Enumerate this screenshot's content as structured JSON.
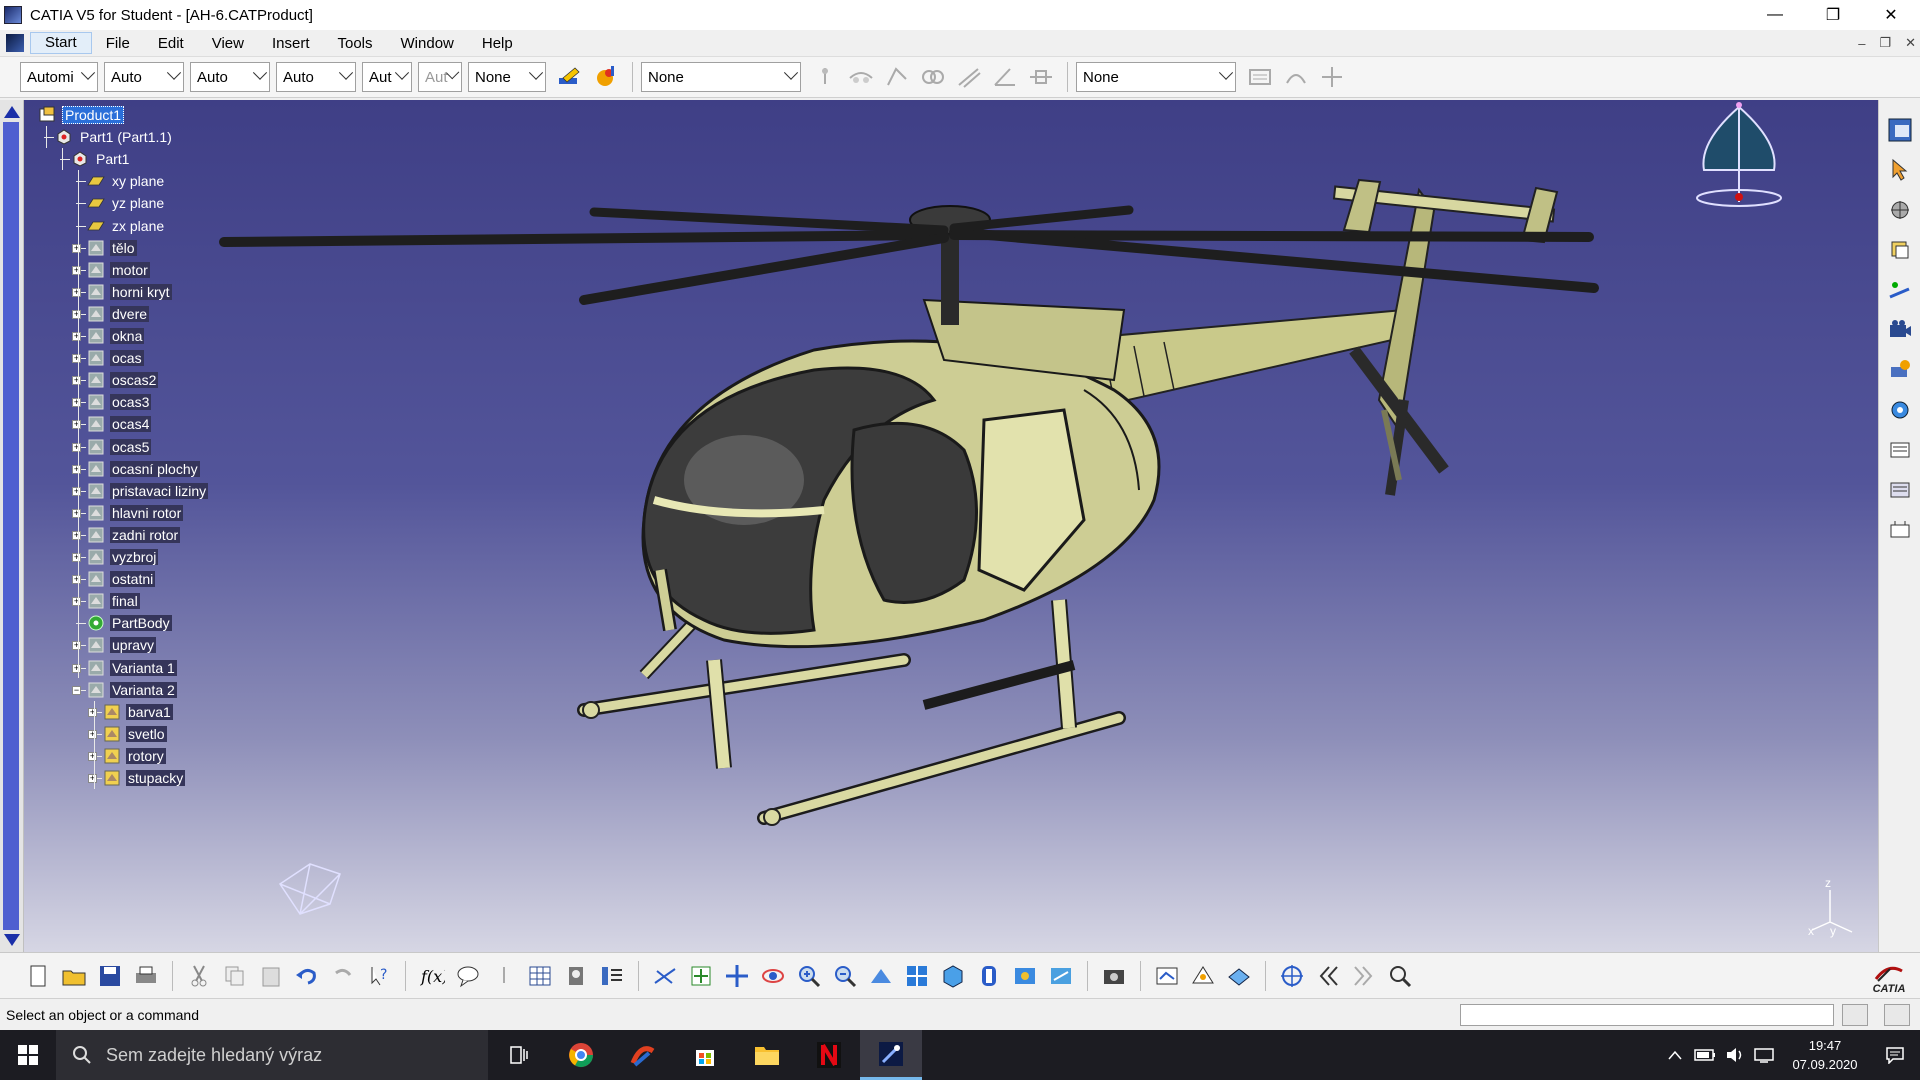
{
  "window": {
    "title": "CATIA V5 for Student - [AH-6.CATProduct]",
    "minimize": "—",
    "restore": "❐",
    "close": "✕"
  },
  "menu": {
    "items": [
      "Start",
      "File",
      "Edit",
      "View",
      "Insert",
      "Tools",
      "Window",
      "Help"
    ],
    "mdi_min": "–",
    "mdi_restore": "❐",
    "mdi_close": "✕"
  },
  "toolbar": {
    "combo1": "Automi",
    "combo2": "Auto",
    "combo3": "Auto",
    "combo4": "Auto",
    "combo5": "Aut",
    "combo6": "Aut",
    "combo7": "None",
    "combo8": "None",
    "combo9": "None"
  },
  "tree": {
    "root": "Product1",
    "part_instance": "Part1 (Part1.1)",
    "part": "Part1",
    "items": [
      "xy plane",
      "yz plane",
      "zx plane",
      "tělo",
      "motor",
      "horni kryt",
      "dvere",
      "okna",
      "ocas",
      "oscas2",
      "ocas3",
      "ocas4",
      "ocas5",
      "ocasní plochy",
      "pristavaci liziny",
      "hlavni rotor",
      "zadni rotor",
      "vyzbroj",
      "ostatni",
      "final",
      "PartBody",
      "upravy",
      "Varianta 1",
      "Varianta 2"
    ],
    "sub_items": [
      "barva1",
      "svetlo",
      "rotory",
      "stupacky"
    ]
  },
  "compass": {
    "x": "x",
    "y": "y",
    "z": "z"
  },
  "status": {
    "message": "Select an object or a command"
  },
  "logo": {
    "text": "CATIA"
  },
  "taskbar": {
    "search_placeholder": "Sem zadejte hledaný výraz",
    "time": "19:47",
    "date": "07.09.2020"
  }
}
